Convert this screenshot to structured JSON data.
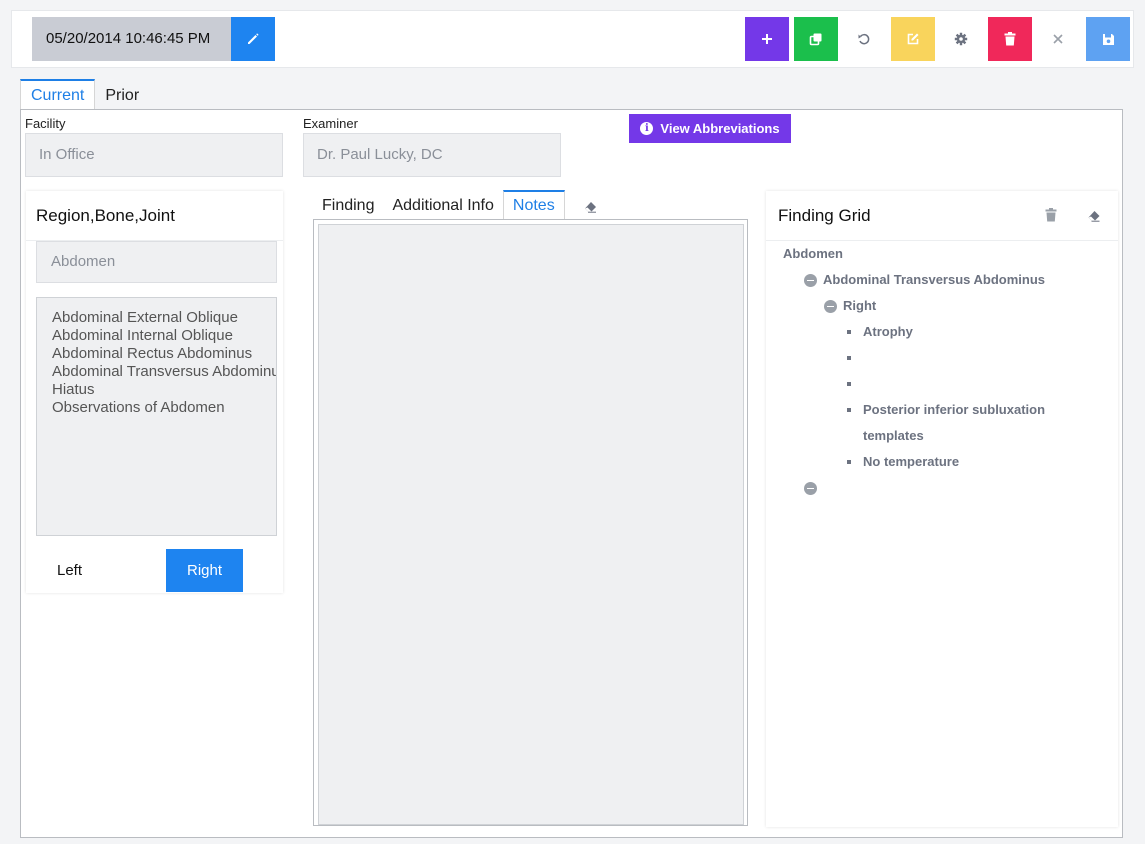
{
  "toolbar": {
    "datetime": "05/20/2014 10:46:45 PM",
    "buttons": [
      {
        "name": "edit-date-button",
        "icon": "pencil-icon",
        "color": "#1e84f0"
      },
      {
        "name": "add-button",
        "icon": "plus-icon",
        "color": "#7438e8"
      },
      {
        "name": "copy-button",
        "icon": "copy-icon",
        "color": "#1bbf4c"
      },
      {
        "name": "undo-button",
        "icon": "undo-icon",
        "color": "#ffffff"
      },
      {
        "name": "edit-note-button",
        "icon": "edit-square-icon",
        "color": "#f9d45c"
      },
      {
        "name": "settings-button",
        "icon": "gear-icon",
        "color": "#ffffff"
      },
      {
        "name": "delete-button",
        "icon": "trash-icon",
        "color": "#f0285a"
      },
      {
        "name": "close-button",
        "icon": "close-icon",
        "color": "#ffffff"
      },
      {
        "name": "save-button",
        "icon": "save-icon",
        "color": "#5ea2f2"
      }
    ]
  },
  "main_tabs": {
    "current": "Current",
    "prior": "Prior",
    "active": "Current"
  },
  "facility": {
    "label": "Facility",
    "value": "In Office"
  },
  "examiner": {
    "label": "Examiner",
    "value": "Dr. Paul Lucky, DC"
  },
  "view_abbreviations": {
    "label": "View Abbreviations",
    "icon": "info-icon"
  },
  "region_card": {
    "title": "Region,Bone,Joint",
    "region_value": "Abdomen",
    "items": [
      "Abdominal External Oblique",
      "Abdominal Internal Oblique",
      "Abdominal Rectus Abdominus",
      "Abdominal Transversus Abdominus",
      "Hiatus",
      "Observations of Abdomen"
    ],
    "left_label": "Left",
    "right_label": "Right",
    "selected_side": "Right"
  },
  "middle_tabs": {
    "finding": "Finding",
    "additional_info": "Additional Info",
    "notes": "Notes",
    "active": "Notes"
  },
  "finding_grid": {
    "title": "Finding Grid",
    "tree": {
      "root": "Abdomen",
      "level1": "Abdominal Transversus Abdominus",
      "level2": "Right",
      "findings": [
        "Atrophy",
        "",
        "",
        "Posterior inferior subluxation",
        "templates",
        "No temperature"
      ]
    }
  },
  "colors": {
    "accent_blue": "#1e7fe6",
    "purple": "#7438e8",
    "green": "#1bbf4c",
    "yellow": "#f9d45c",
    "red": "#f0285a",
    "light_blue": "#5ea2f2"
  }
}
